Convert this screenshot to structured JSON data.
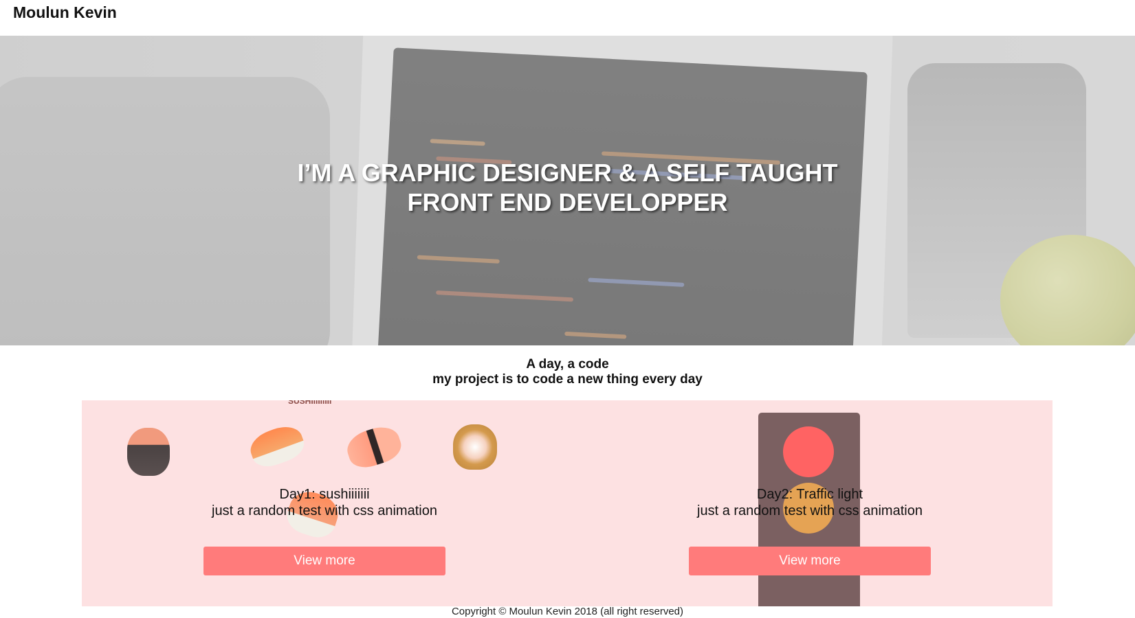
{
  "header": {
    "brand": "Moulun Kevin"
  },
  "hero": {
    "title_line1": "I’M A GRAPHIC DESIGNER & A SELF TAUGHT",
    "title_line2": "FRONT END DEVELOPPER"
  },
  "intro": {
    "line1": "A day, a code",
    "line2": "my project is to code a new thing every day"
  },
  "projects": [
    {
      "title": "Day1: sushiiiiiii",
      "description": "just a random test with css animation",
      "button": "View more",
      "preview_caption": "SUSHIIIIIIIII"
    },
    {
      "title": "Day2: Traffic light",
      "description": "just a random test with css animation",
      "button": "View more"
    }
  ],
  "footer": {
    "text": "Copyright © Moulun Kevin 2018 (all right reserved)"
  },
  "colors": {
    "project_bg": "#fde1e2",
    "button_bg": "#ff7b7b",
    "traffic_body": "#7b6061",
    "light_red": "#ff6363",
    "light_amber": "#e5a354"
  }
}
